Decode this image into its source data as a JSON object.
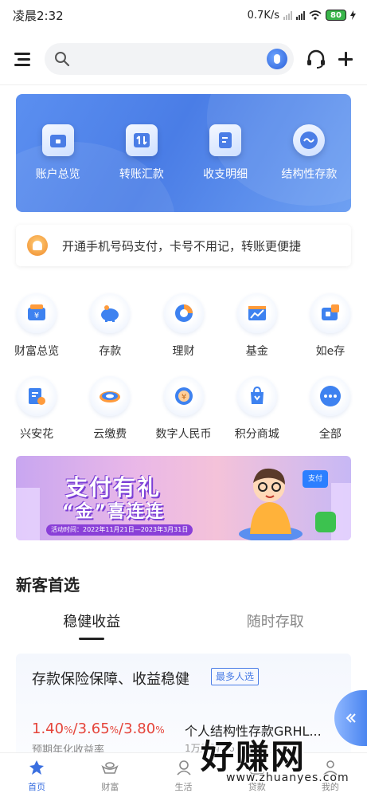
{
  "status_bar": {
    "time": "凌晨2:32",
    "network_speed": "0.7K/s",
    "battery": "80"
  },
  "search": {
    "placeholder": "",
    "value": ""
  },
  "quick_actions": [
    {
      "label": "账户总览",
      "icon": "wallet-icon"
    },
    {
      "label": "转账汇款",
      "icon": "transfer-icon"
    },
    {
      "label": "收支明细",
      "icon": "statement-icon"
    },
    {
      "label": "结构性存款",
      "icon": "structured-deposit-icon"
    }
  ],
  "notice": {
    "text": "开通手机号码支付，卡号不用记，转账更便捷"
  },
  "services": [
    [
      {
        "label": "财富总览",
        "icon": "wealth-icon"
      },
      {
        "label": "存款",
        "icon": "piggy-bank-icon"
      },
      {
        "label": "理财",
        "icon": "finance-pie-icon"
      },
      {
        "label": "基金",
        "icon": "fund-chart-icon"
      },
      {
        "label": "如e存",
        "icon": "deposit-puzzle-icon"
      }
    ],
    [
      {
        "label": "兴安花",
        "icon": "credit-card-icon"
      },
      {
        "label": "云缴费",
        "icon": "cloud-payment-icon"
      },
      {
        "label": "数字人民币",
        "icon": "digital-rmb-icon"
      },
      {
        "label": "积分商城",
        "icon": "shopping-bag-icon"
      },
      {
        "label": "全部",
        "icon": "more-dots-icon"
      }
    ]
  ],
  "banner": {
    "title_line1": "支付有礼",
    "title_line2": "“金”喜连连",
    "date_range": "活动时间：2022年11月21日—2023年3月31日",
    "pay_tag": "支付"
  },
  "section": {
    "title": "新客首选"
  },
  "tabs": [
    {
      "label": "稳健收益",
      "active": true
    },
    {
      "label": "随时存取",
      "active": false
    }
  ],
  "product": {
    "title": "存款保险保障、收益稳健",
    "badge": "最多人选",
    "rate_1": "1.40",
    "rate_2": "3.65",
    "rate_3": "3.80",
    "percent": "%",
    "slash": "/",
    "rate_label": "预期年化收益率",
    "name": "个人结构性存款GRHL...",
    "sub": "1万起购 | 6"
  },
  "bottom_nav": [
    {
      "label": "首页",
      "icon": "home-icon",
      "active": true
    },
    {
      "label": "财富",
      "icon": "ingot-icon",
      "active": false
    },
    {
      "label": "生活",
      "icon": "life-icon",
      "active": false
    },
    {
      "label": "贷款",
      "icon": "loan-icon",
      "active": false
    },
    {
      "label": "我的",
      "icon": "profile-icon",
      "active": false
    }
  ],
  "watermark": {
    "main": "好赚网",
    "url": "www.zhuanyes.com"
  },
  "colors": {
    "primary_blue": "#4a7de6",
    "rate_red": "#e5443a",
    "battery_green": "#39b54a"
  }
}
